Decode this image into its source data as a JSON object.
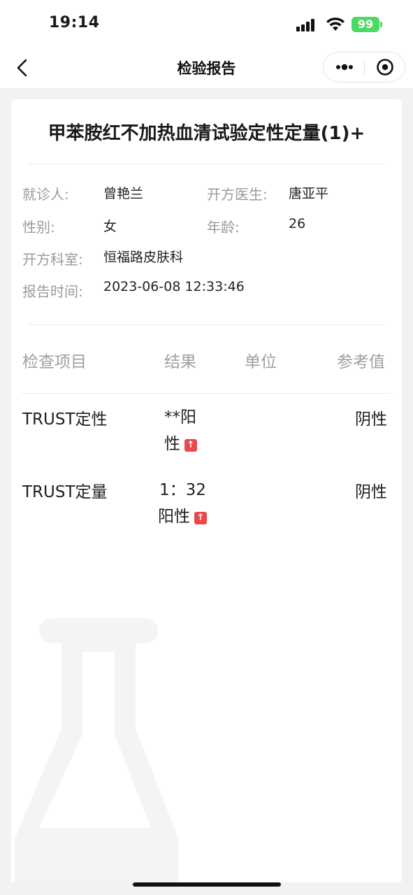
{
  "status_bar": {
    "time": "19:14",
    "battery": "99"
  },
  "nav": {
    "title": "检验报告"
  },
  "report": {
    "title": "甲苯胺红不加热血清试验定性定量(1)+",
    "info": {
      "patient_label": "就诊人:",
      "patient_value": "曾艳兰",
      "doctor_label": "开方医生:",
      "doctor_value": "唐亚平",
      "gender_label": "性别:",
      "gender_value": "女",
      "age_label": "年龄:",
      "age_value": "26",
      "dept_label": "开方科室:",
      "dept_value": "恒福路皮肤科",
      "time_label": "报告时间:",
      "time_value": "2023-06-08 12:33:46"
    },
    "table": {
      "headers": [
        "检查项目",
        "结果",
        "单位",
        "参考值"
      ],
      "rows": [
        {
          "item": "TRUST定性",
          "result_line1": "**阳",
          "result_line2": "性",
          "unit": "",
          "reference": "阴性",
          "flag": "↑"
        },
        {
          "item": "TRUST定量",
          "result_line1": "1：32",
          "result_line2": "阳性",
          "unit": "",
          "reference": "阴性",
          "flag": "↑"
        }
      ]
    }
  },
  "colors": {
    "flag_red": "#e84a4a",
    "battery_green": "#4cd964",
    "label_gray": "#9a9a9a"
  },
  "icons": [
    "back-chevron-icon",
    "more-dots-icon",
    "close-target-icon",
    "flask-watermark-icon",
    "arrow-up-icon"
  ]
}
